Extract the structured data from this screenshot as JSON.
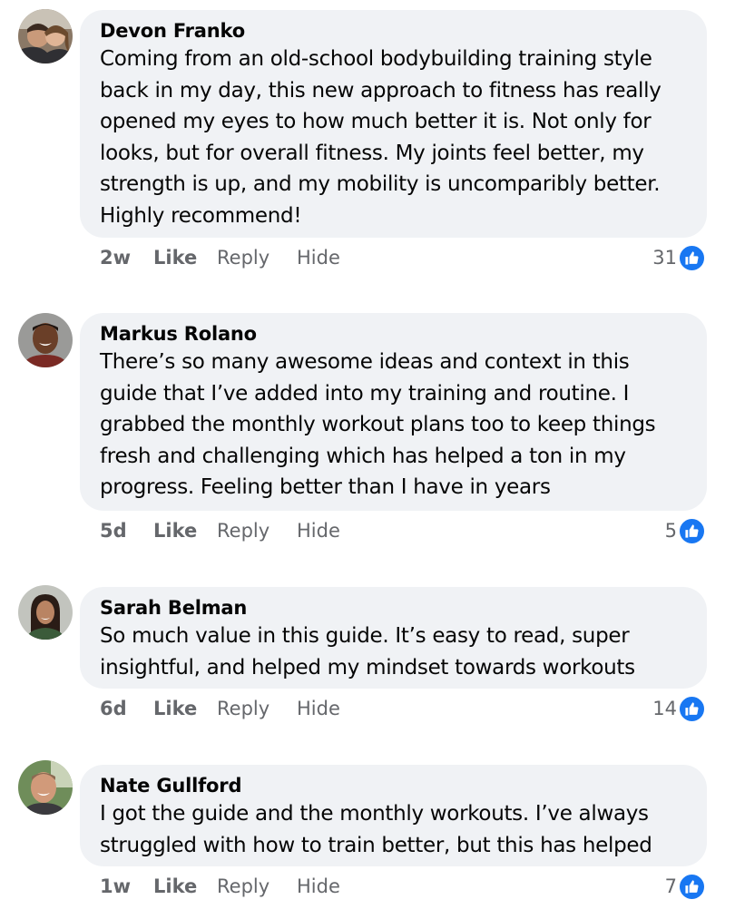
{
  "comments": [
    {
      "author": "Devon Franko",
      "text": "Coming from an old-school bodybuilding training style back in my day, this new approach to fitness has really opened my eyes to how much better it is. Not only for looks, but for overall fitness. My joints feel better, my strength is up, and my mobility is uncomparibly better. Highly recommend!",
      "time": "2w",
      "like_label": "Like",
      "reply_label": "Reply",
      "hide_label": "Hide",
      "reaction_count": "31",
      "reaction_icon": "thumbs-up-icon"
    },
    {
      "author": "Markus Rolano",
      "text": "There’s so many awesome ideas and context in this guide that I’ve added into my training and routine. I grabbed the monthly workout plans too to keep things fresh and challenging which has helped a ton in my progress. Feeling better than I have in years",
      "time": "5d",
      "like_label": "Like",
      "reply_label": "Reply",
      "hide_label": "Hide",
      "reaction_count": "5",
      "reaction_icon": "thumbs-up-icon"
    },
    {
      "author": "Sarah Belman",
      "text": "So much value in this guide. It’s easy to read, super insightful, and helped my mindset towards workouts",
      "time": "6d",
      "like_label": "Like",
      "reply_label": "Reply",
      "hide_label": "Hide",
      "reaction_count": "14",
      "reaction_icon": "thumbs-up-icon"
    },
    {
      "author": "Nate Gullford",
      "text": "I got the guide and the monthly workouts. I’ve always struggled with how to train better, but this has helped",
      "time": "1w",
      "like_label": "Like",
      "reply_label": "Reply",
      "hide_label": "Hide",
      "reaction_count": "7",
      "reaction_icon": "thumbs-up-icon"
    }
  ],
  "colors": {
    "bubble_background": "#f0f2f5",
    "primary_text": "#050505",
    "secondary_text": "#65676b",
    "like_blue": "#1877f2"
  }
}
